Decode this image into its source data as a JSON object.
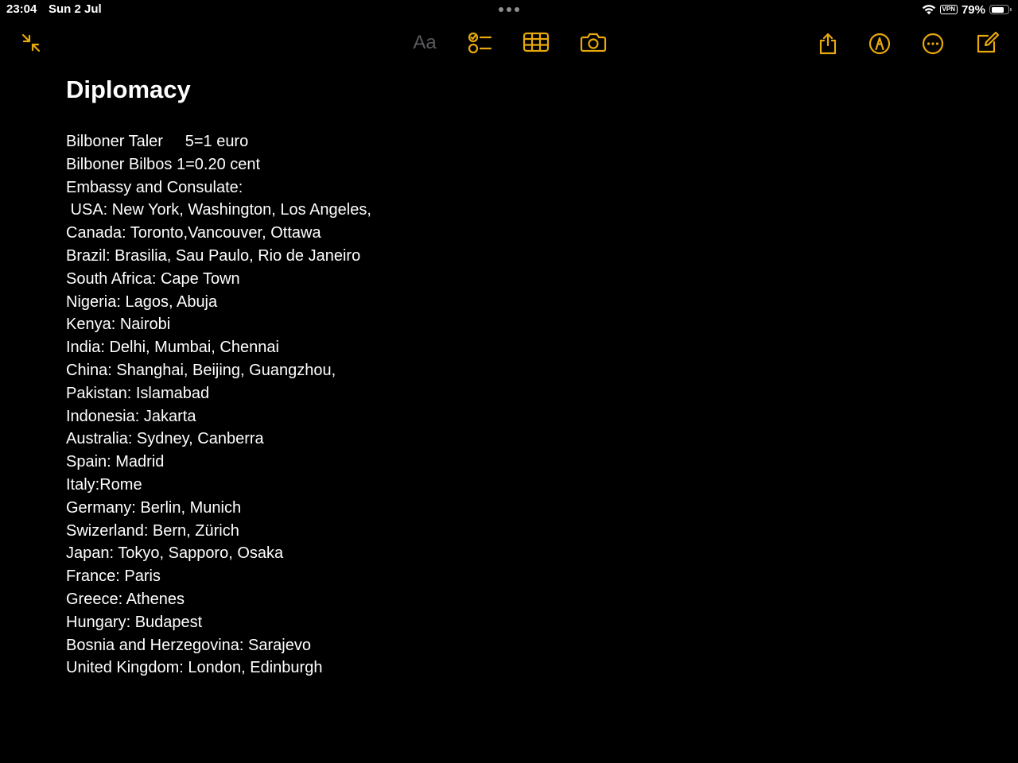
{
  "status_bar": {
    "time": "23:04",
    "date": "Sun 2 Jul",
    "vpn": "VPN",
    "battery_percent": "79%",
    "battery_level": 0.79
  },
  "toolbar": {
    "format_label": "Aa",
    "accent_color": "#E8A90C",
    "icons": [
      "collapse-icon",
      "checklist-icon",
      "table-icon",
      "camera-icon",
      "share-icon",
      "markup-icon",
      "more-icon",
      "compose-icon"
    ]
  },
  "note": {
    "title": "Diplomacy",
    "lines": [
      "Bilboner Taler     5=1 euro",
      "Bilboner Bilbos 1=0.20 cent",
      "Embassy and Consulate:",
      " USA: New York, Washington, Los Angeles,",
      "Canada: Toronto,Vancouver, Ottawa",
      "Brazil: Brasilia, Sau Paulo, Rio de Janeiro",
      "South Africa: Cape Town",
      "Nigeria: Lagos, Abuja",
      "Kenya: Nairobi",
      "India: Delhi, Mumbai, Chennai",
      "China: Shanghai, Beijing, Guangzhou,",
      "Pakistan: Islamabad",
      "Indonesia: Jakarta",
      "Australia: Sydney, Canberra",
      "Spain: Madrid",
      "Italy:Rome",
      "Germany: Berlin, Munich",
      "Swizerland: Bern, Zürich",
      "Japan: Tokyo, Sapporo, Osaka",
      "France: Paris",
      "Greece: Athenes",
      "Hungary: Budapest",
      "Bosnia and Herzegovina: Sarajevo",
      "United Kingdom: London, Edinburgh"
    ]
  }
}
